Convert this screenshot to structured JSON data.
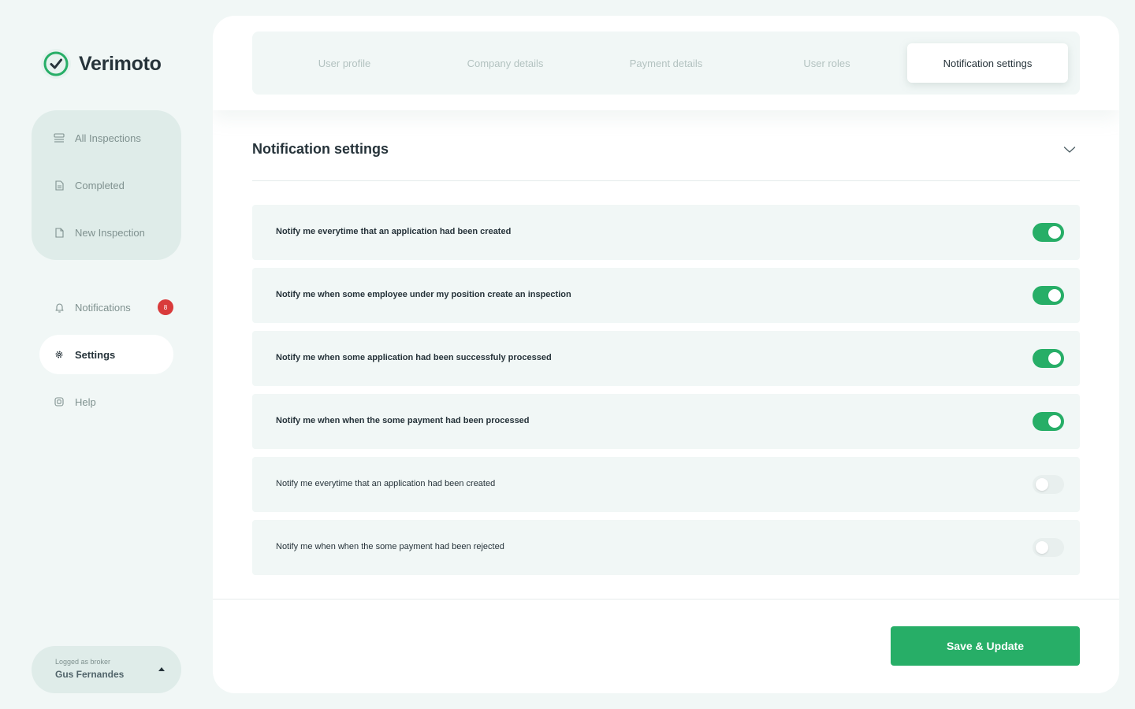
{
  "app": {
    "name": "Verimoto",
    "brand_color": "#27ae67"
  },
  "sidebar": {
    "group_items": [
      {
        "label": "All Inspections",
        "icon": "inspections-icon"
      },
      {
        "label": "Completed",
        "icon": "completed-icon"
      },
      {
        "label": "New Inspection",
        "icon": "new-inspection-icon"
      }
    ],
    "notifications": {
      "label": "Notifications",
      "badge": "8",
      "icon": "bell-icon"
    },
    "settings": {
      "label": "Settings",
      "icon": "gear-icon",
      "active": true
    },
    "help": {
      "label": "Help",
      "icon": "help-icon"
    }
  },
  "user": {
    "role": "Logged as broker",
    "name": "Gus Fernandes"
  },
  "tabs": [
    {
      "label": "User profile",
      "active": false
    },
    {
      "label": "Company details",
      "active": false
    },
    {
      "label": "Payment details",
      "active": false
    },
    {
      "label": "User roles",
      "active": false
    },
    {
      "label": "Notification settings",
      "active": true
    }
  ],
  "section": {
    "title": "Notification settings"
  },
  "settings_list": [
    {
      "label": "Notify me everytime that an application had been created",
      "enabled": true
    },
    {
      "label": "Notify me when some employee under my position create an inspection",
      "enabled": true
    },
    {
      "label": "Notify me when some application had been successfuly processed",
      "enabled": true
    },
    {
      "label": "Notify me when when the some payment had been processed",
      "enabled": true
    },
    {
      "label": "Notify me everytime that an application had been created",
      "enabled": false
    },
    {
      "label": "Notify me when when the some payment had been rejected",
      "enabled": false
    }
  ],
  "footer": {
    "save_label": "Save & Update"
  }
}
